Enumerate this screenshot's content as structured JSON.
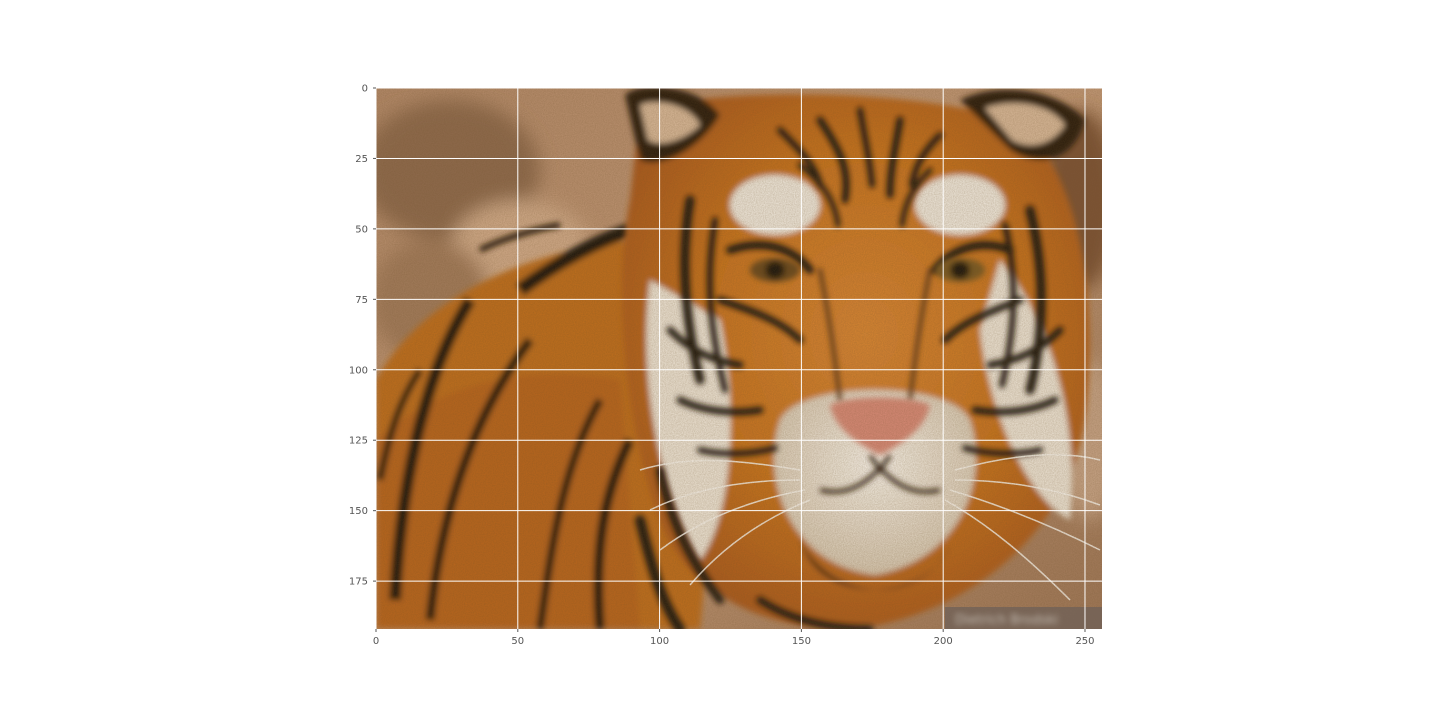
{
  "chart_data": {
    "type": "heatmap",
    "title": "",
    "xlabel": "",
    "ylabel": "",
    "image_subject": "tiger face photograph",
    "image_width": 256,
    "image_height": 192,
    "xlim": [
      0,
      256
    ],
    "ylim": [
      192,
      0
    ],
    "x_ticks": [
      0,
      50,
      100,
      150,
      200,
      250
    ],
    "y_ticks": [
      0,
      25,
      50,
      75,
      100,
      125,
      150,
      175
    ],
    "x_tick_labels": [
      "0",
      "50",
      "100",
      "150",
      "200",
      "250"
    ],
    "y_tick_labels": [
      "0",
      "25",
      "50",
      "75",
      "100",
      "125",
      "150",
      "175"
    ],
    "grid": true,
    "watermark_text": "Dietrich Brodski",
    "colors": {
      "fur_orange": "#c9741f",
      "fur_dark": "#1c130c",
      "fur_white": "#efe6d8",
      "nose": "#d98a78",
      "background": "#b38c6c",
      "grid": "#ffffff",
      "tick_text": "#555555"
    }
  }
}
